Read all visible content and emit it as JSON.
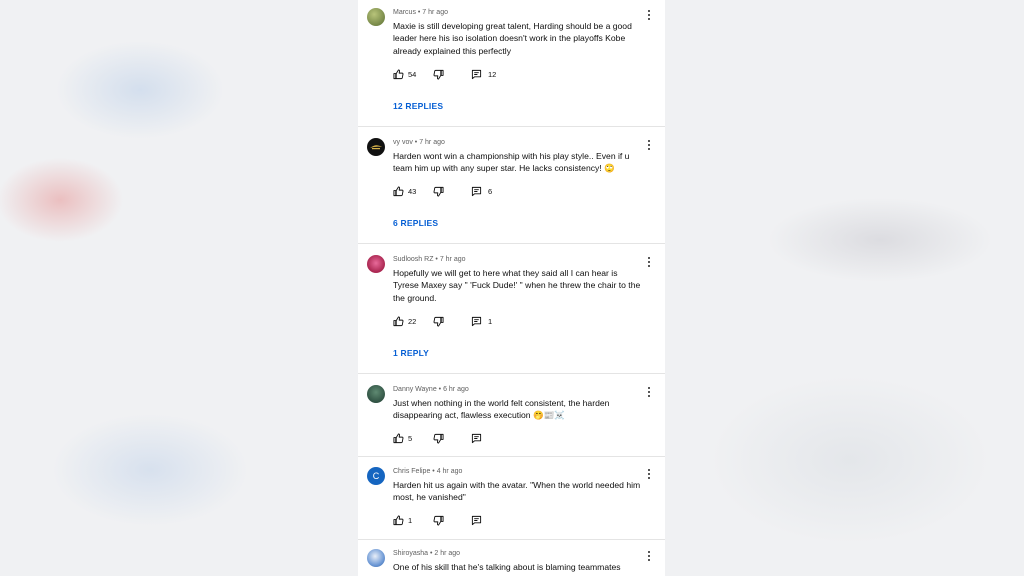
{
  "comments": [
    {
      "author": "Marcus",
      "time": "7 hr ago",
      "text": "Maxie is still developing great talent, Harding should be a good leader here his iso isolation doesn't work in the playoffs Kobe already explained this perfectly",
      "likes": "54",
      "reply_count": "12",
      "replies_label": "12 REPLIES",
      "avatar_icon": "photo-avatar",
      "avatar_color": "#7a8a52"
    },
    {
      "author": "vy vov",
      "time": "7 hr ago",
      "text": "Harden wont win a championship with his play style.. Even if u team him up with any super star. He lacks consistency! 🙄",
      "likes": "43",
      "reply_count": "6",
      "replies_label": "6 REPLIES",
      "avatar_icon": "logo-avatar",
      "avatar_color": "#111111"
    },
    {
      "author": "Sudloosh RZ",
      "time": "7 hr ago",
      "text": "Hopefully we will get to here what they said all I can hear is Tyrese Maxey say \" 'Fuck Dude!' \" when he threw the chair to the the ground.",
      "likes": "22",
      "reply_count": "1",
      "replies_label": "1 REPLY",
      "avatar_icon": "character-avatar",
      "avatar_color": "#c23a6a"
    },
    {
      "author": "Danny Wayne",
      "time": "6 hr ago",
      "text": "Just when nothing in the world felt consistent, the harden disappearing act, flawless execution 🤭📰☠️",
      "likes": "5",
      "avatar_icon": "photo-avatar",
      "avatar_color": "#2e5a48"
    },
    {
      "author": "Chris Felipe",
      "time": "4 hr ago",
      "text": "Harden hit us again with the avatar. \"When the world needed him most, he vanished\"",
      "likes": "1",
      "avatar_icon": "letter-avatar",
      "avatar_letter": "C",
      "avatar_color": "#1565c0"
    },
    {
      "author": "Shiroyasha",
      "time": "2 hr ago",
      "text": "One of his skill that he's talking about is blaming teammates",
      "avatar_icon": "anime-avatar",
      "avatar_color": "#5b8fd0"
    }
  ]
}
